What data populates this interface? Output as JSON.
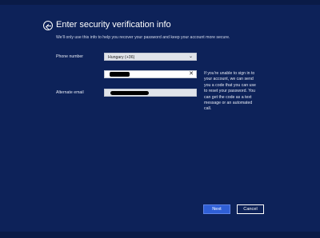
{
  "header": {
    "title": "Enter security verification info",
    "subtitle": "We'll only use this info to help you recover your password and keep your account more secure."
  },
  "form": {
    "phone_label": "Phone number",
    "country_selected": "Hungary (+36)",
    "phone_value": "",
    "email_label": "Alternate email",
    "email_value": ""
  },
  "help_text": "If you're unable to sign in to your account, we can send you a code that you can use to reset your password. You can get the code as a text message or an automated call.",
  "buttons": {
    "next": "Next",
    "cancel": "Cancel"
  },
  "icons": {
    "back": "back-arrow-icon",
    "select_chevron": "chevron-down-icon",
    "clear": "close-icon"
  }
}
